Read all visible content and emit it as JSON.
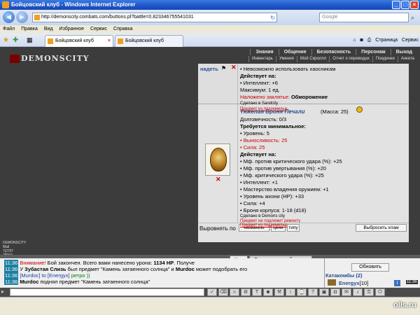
{
  "window": {
    "title": "Бойцовский клуб - Windows Internet Explorer"
  },
  "address": {
    "url": "http://demonscity.combats.com/buttons.pl?battle=0.823346755541031",
    "search_placeholder": "Google"
  },
  "menu": [
    "Файл",
    "Правка",
    "Вид",
    "Избранное",
    "Сервис",
    "Справка"
  ],
  "tabs": [
    "Бойцовский клуб",
    "Бойцовский клуб"
  ],
  "tabtools": {
    "page": "Страница",
    "service": "Сервис"
  },
  "game": {
    "logo": "DEMONSCITY",
    "nav": [
      "Знания",
      "Общение",
      "Безопасность",
      "Персонаж",
      "Выход"
    ],
    "subnav": [
      "Инвентарь",
      "Умения",
      "Мой Скроллл",
      "Отчет о переводах",
      "Поединки",
      "Анкета"
    ]
  },
  "top_item": {
    "equip_link": "надеть",
    "lines": [
      {
        "text": "• Невозможно использовать хаосникам",
        "style": ""
      },
      {
        "text": "Действует на:",
        "style": "b"
      },
      {
        "text": "• Интеллект: +6",
        "style": ""
      },
      {
        "text": "Максимум: 1 ед.",
        "style": ""
      },
      {
        "text": "Наложено заклятье: ",
        "style": "red",
        "extra": "Обморожение"
      },
      {
        "text": "Сделано в Sandcity",
        "style": "tinyk"
      },
      {
        "text": "Предмет из подземелья",
        "style": "tiny"
      }
    ]
  },
  "item": {
    "name": "Тяжелая Броня Печали",
    "mass": "(Масса: 25)",
    "durability": "Долговечность: 0/3",
    "req_title": "Требуется минимальное:",
    "reqs": [
      {
        "text": "• Уровень: 5",
        "red": false
      },
      {
        "text": "• Выносливость: 25",
        "red": true
      },
      {
        "text": "• Сила: 25",
        "red": true
      }
    ],
    "effects_title": "Действует на:",
    "effects": [
      "• Мф. против критического удара (%): +25",
      "• Мф. против увертывания (%): +20",
      "• Мф. критического удара (%): +25",
      "• Интеллект: +1",
      "• Мастерство владения оружием: +1",
      "• Уровень жизни (HP): +33",
      "• Сила: +4",
      "• Броня корпуса: 1-18 (d18)"
    ],
    "made": "Сделано в Demons city",
    "note1": "Предмет не подлежит ремонту",
    "note2": "Предмет из подземелья"
  },
  "sort": {
    "label": "Выровнять по",
    "by_name": "названию",
    "by_price": "цене",
    "by_type": "типу",
    "throw": "Выбросить хлам"
  },
  "ministats": [
    "DEMONSCITY",
    "Mail",
    "7|2707",
    "28004"
  ],
  "chat_tabs": {
    "chat": "Чат",
    "system": "Системные сообщения"
  },
  "chat": [
    {
      "time": "11:36",
      "html": "<span class='red'>Внимание!</span> Бой закончен. Всего вами нанесено урона: <b>1134 HP</b>. Получе"
    },
    {
      "time": "11:36",
      "html": "У <b>Зубастая Слизь</b> был предмет \"Камень затаенного солнца\" и <b>Murdoc</b> может подобрать его"
    },
    {
      "time": "11:36",
      "html": "<span class='blue'>[Murdoc] to [Energyx]</span> <span class='green'>ретро ))</span>"
    },
    {
      "time": "11:36",
      "html": "<b>Murdoc</b> поднял предмет \"Камень затаенного солнца\""
    }
  ],
  "right_panel": {
    "refresh": "Обновить",
    "location": "Катакомбы (2)",
    "user": "Energyx",
    "user_level": "[10]",
    "clock": "11:36"
  },
  "status": {
    "watermark": "olls.ru"
  }
}
